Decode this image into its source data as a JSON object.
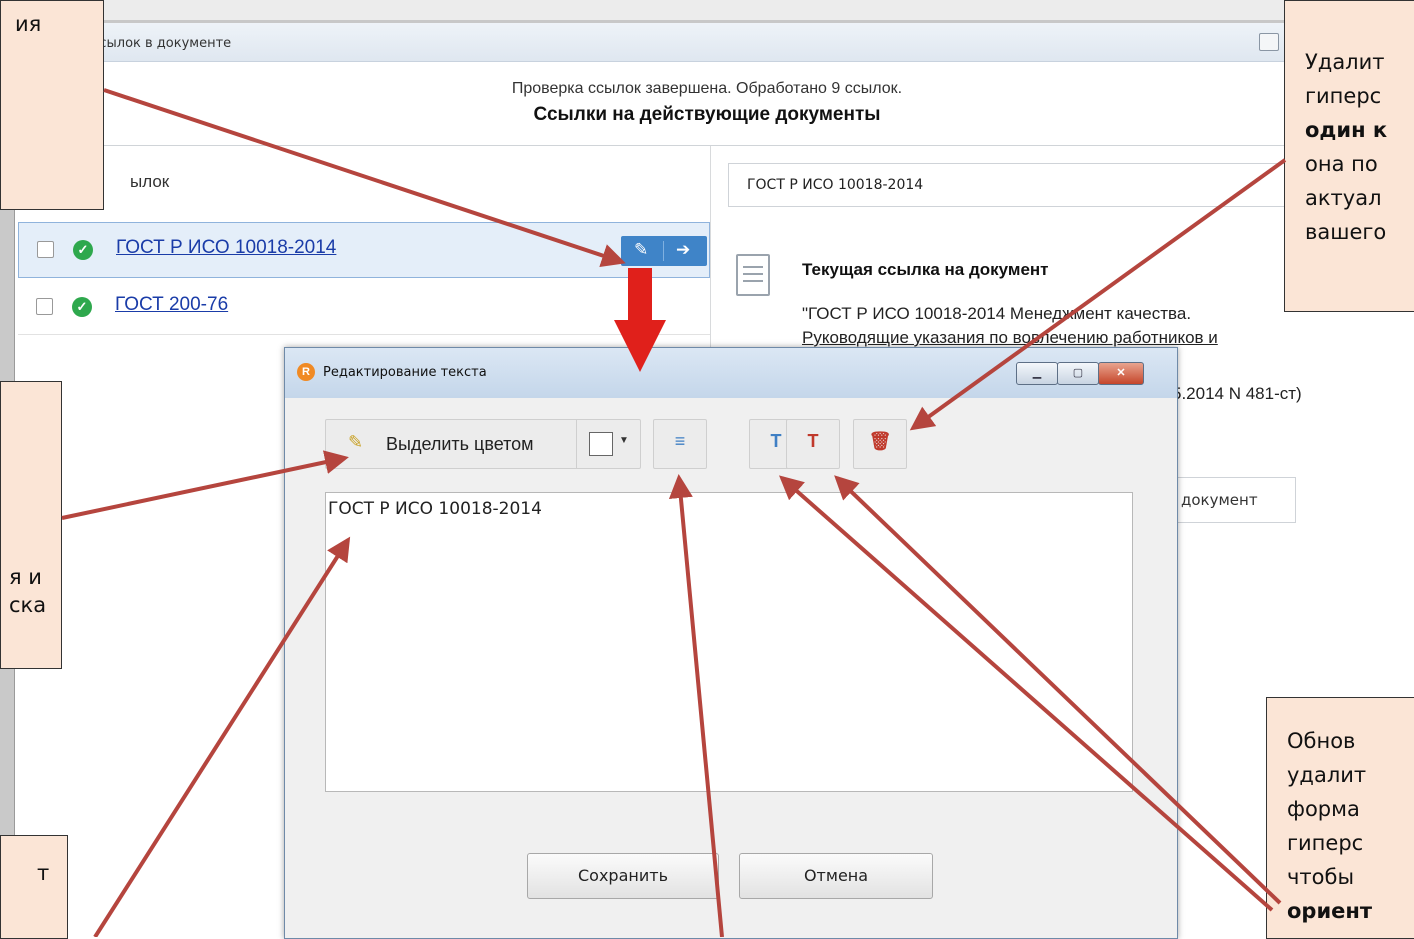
{
  "window": {
    "title": "рка ссылок в документе"
  },
  "status": {
    "line": "Проверка ссылок завершена. Обработано 9 ссылок.",
    "section_title": "Ссылки на действующие документы"
  },
  "links_panel": {
    "header": "ылок",
    "rows": [
      {
        "label": "ГОСТ Р ИСО 10018-2014",
        "status": "valid"
      },
      {
        "label": "ГОСТ 200-76",
        "status": "valid"
      }
    ],
    "actions": {
      "edit_icon": "✎",
      "go_icon": "➔"
    }
  },
  "detail_panel": {
    "search_value": "ГОСТ Р ИСО 10018-2014",
    "current_ref_title": "Текущая ссылка на документ",
    "current_ref_line1": "\"ГОСТ Р ИСО 10018-2014 Менеджмент качества.",
    "current_ref_line2": "Руководящие указания по вовлечению работников и",
    "date_fragment": "5.2014 N 481-ст)",
    "open_doc_fragment": "документ"
  },
  "dialog": {
    "title": "Редактирование текста",
    "app_icon": "R",
    "highlight_label": "Выделить цветом",
    "text_value": "ГОСТ Р ИСО 10018-2014",
    "save_label": "Сохранить",
    "cancel_label": "Отмена",
    "toolbar_icons": {
      "refresh_text": "≡",
      "refresh_format": "T",
      "clear_format": "T",
      "delete": "🗑"
    },
    "window_buttons": {
      "minimize": "▁",
      "maximize": "▢",
      "close": "✕"
    }
  },
  "callouts": {
    "top_left": [
      "ия"
    ],
    "mid_left": [
      "я и",
      "ска"
    ],
    "bottom_left": [
      "т"
    ],
    "top_right": [
      "Удалит",
      "гиперс",
      "один к",
      "она по",
      "актуал",
      "вашего"
    ],
    "bottom_right": [
      "Обнов",
      "удалит",
      "форма",
      "гиперс",
      "чтобы",
      "ориент"
    ]
  },
  "colors": {
    "callout_bg": "#fbe5d6",
    "arrow": "#b5453e",
    "accent_blue": "#3f84c8",
    "ok_green": "#2ea84d",
    "red_arrow": "#e0201b"
  }
}
